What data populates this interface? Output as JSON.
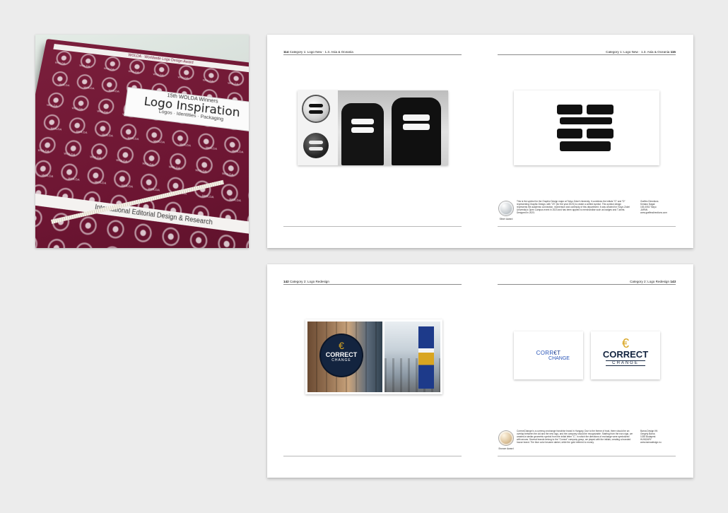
{
  "book": {
    "top_strip": "WOLDA · Worldwide Logo Design Award",
    "series": "15th WOLDA Winners",
    "title": "Logo Inspiration",
    "subtitle": "Logos · Identities · Packaging",
    "band": "International Editorial Design & Research",
    "pattern_word": "WOLDA"
  },
  "spread1": {
    "left_folio": "114",
    "left_header": "Category 1: Logo New · 1.3. Asia & Oceania",
    "right_header": "Category 1: Logo New · 1.3. Asia & Oceania",
    "right_folio": "115",
    "award": "Silver Award",
    "description": "This is the symbol for the Graphic Design major at Tokyo Zokei University. It combines the initials \"G\" and \"D\" representing Graphic Design, with \"23\" (for the year 2023) to create a unified symbol. This symbol design represents the academic connection, momentum and continuity of this department. It was created for Tokyo Zokei University's Open Campus event in 2023 and has been applied to merchandise such as badges and T-shirts. Designed in 2023.",
    "credit": [
      "Graffes Directions",
      "Kentaro Nagai",
      "153-0052 Tokyo",
      "JAPAN",
      "www.graffesdirections.com"
    ]
  },
  "spread2": {
    "left_folio": "142",
    "left_header": "Category 2: Logo Redesign",
    "right_header": "Category 2: Logo Redesign",
    "right_folio": "143",
    "award": "Bronze Award",
    "logo_old_line1": "CORR",
    "logo_old_mid": "€T",
    "logo_old_line2": "CHANGE",
    "logo_new_symbol": "€",
    "logo_new_word": "CORRECT",
    "logo_new_word2": "CHANGE",
    "sign_word": "CORRECT",
    "sign_word2": "CHANGE",
    "description": "CorrectChange is a currency-exchange franchise brand in Hungary. Due to the theme of trust, there should be an overlap between the old and the new logo, and the company should be recognizable. Starting from the euro sign, we created a similar geometric symbol from the initial letter \"C\", in which the directions of exchange were symbolized with arrows. Several brands belong to the \"Correct\" company group, we played with the initials, creating a branded house brand. The blue color became darker, while the gold referred to money.",
    "credit": [
      "Barna Design Kft.",
      "Gergely Barna",
      "1035 Budapest",
      "HUNGARY",
      "www.barnadesign.eu"
    ]
  },
  "colors": {
    "book": "#6c1532",
    "correct_blue": "#1d3a8a",
    "correct_gold": "#d9a521",
    "background": "#ececec"
  }
}
